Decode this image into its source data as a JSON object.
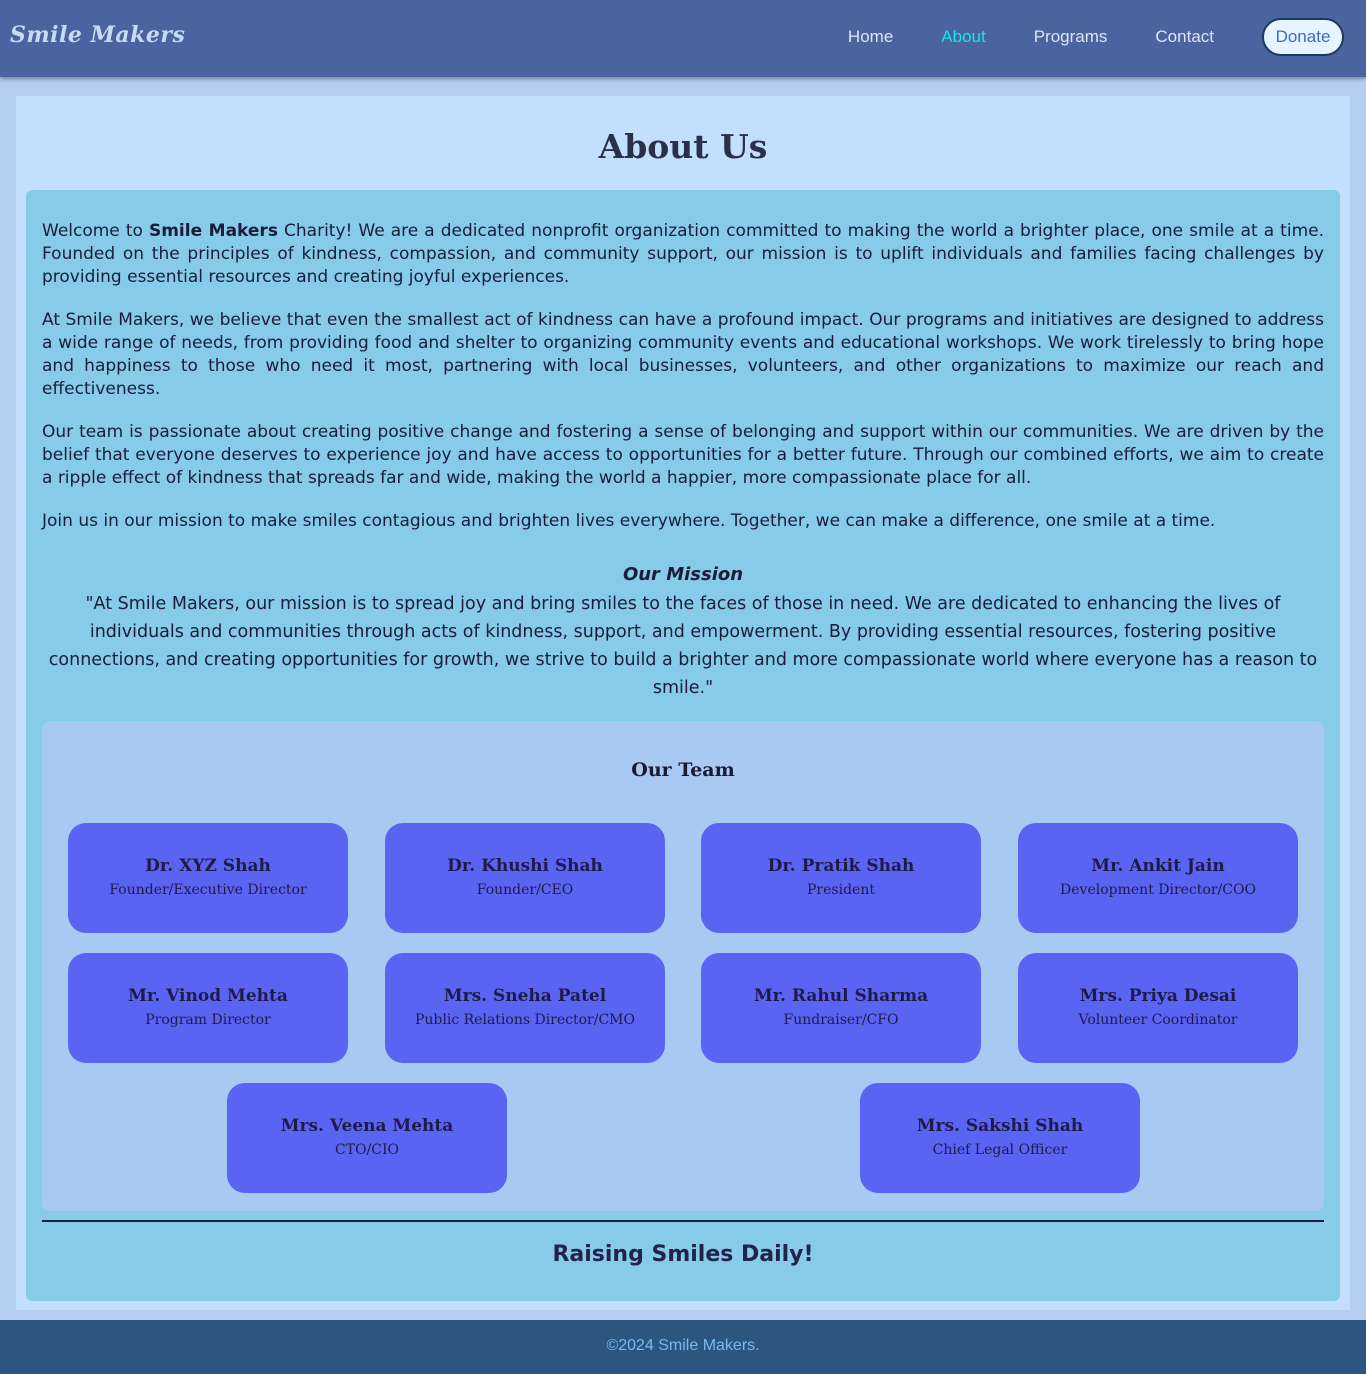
{
  "brand": {
    "name": "Smile Makers"
  },
  "nav": {
    "links": [
      {
        "label": "Home",
        "active": false
      },
      {
        "label": "About",
        "active": true
      },
      {
        "label": "Programs",
        "active": false
      },
      {
        "label": "Contact",
        "active": false
      }
    ],
    "donate_label": "Donate"
  },
  "colors": {
    "active_link": "#14e6f0",
    "navbar": "#4a64a0",
    "card": "#5964f2",
    "footer": "#2b5680"
  },
  "about": {
    "title": "About Us",
    "intro": {
      "prefix": "Welcome to ",
      "highlight": "Smile Makers",
      "rest": " Charity! We are a dedicated nonprofit organization committed to making the world a brighter place, one smile at a time. Founded on the principles of kindness, compassion, and community support, our mission is to uplift individuals and families facing challenges by providing essential resources and creating joyful experiences."
    },
    "paragraphs": [
      "At Smile Makers, we believe that even the smallest act of kindness can have a profound impact. Our programs and initiatives are designed to address a wide range of needs, from providing food and shelter to organizing community events and educational workshops. We work tirelessly to bring hope and happiness to those who need it most, partnering with local businesses, volunteers, and other organizations to maximize our reach and effectiveness.",
      "Our team is passionate about creating positive change and fostering a sense of belonging and support within our communities. We are driven by the belief that everyone deserves to experience joy and have access to opportunities for a better future. Through our combined efforts, we aim to create a ripple effect of kindness that spreads far and wide, making the world a happier, more compassionate place for all.",
      "Join us in our mission to make smiles contagious and brighten lives everywhere. Together, we can make a difference, one smile at a time."
    ]
  },
  "mission": {
    "title": "Our Mission",
    "text": "\"At Smile Makers, our mission is to spread joy and bring smiles to the faces of those in need. We are dedicated to enhancing the lives of individuals and communities through acts of kindness, support, and empowerment. By providing essential resources, fostering positive connections, and creating opportunities for growth, we strive to build a brighter and more compassionate world where everyone has a reason to smile.\""
  },
  "team": {
    "title": "Our Team",
    "members": [
      {
        "name": "Dr. XYZ Shah",
        "role": "Founder/Executive Director"
      },
      {
        "name": "Dr. Khushi Shah",
        "role": "Founder/CEO"
      },
      {
        "name": "Dr. Pratik Shah",
        "role": "President"
      },
      {
        "name": "Mr. Ankit Jain",
        "role": "Development Director/COO"
      },
      {
        "name": "Mr. Vinod Mehta",
        "role": "Program Director"
      },
      {
        "name": "Mrs. Sneha Patel",
        "role": "Public Relations Director/CMO"
      },
      {
        "name": "Mr. Rahul Sharma",
        "role": "Fundraiser/CFO"
      },
      {
        "name": "Mrs. Priya Desai",
        "role": "Volunteer Coordinator"
      },
      {
        "name": "Mrs. Veena Mehta",
        "role": "CTO/CIO"
      },
      {
        "name": "Mrs. Sakshi Shah",
        "role": "Chief Legal Officer"
      }
    ]
  },
  "tagline": "Raising Smiles Daily!",
  "footer": {
    "text": "©2024 Smile Makers."
  }
}
